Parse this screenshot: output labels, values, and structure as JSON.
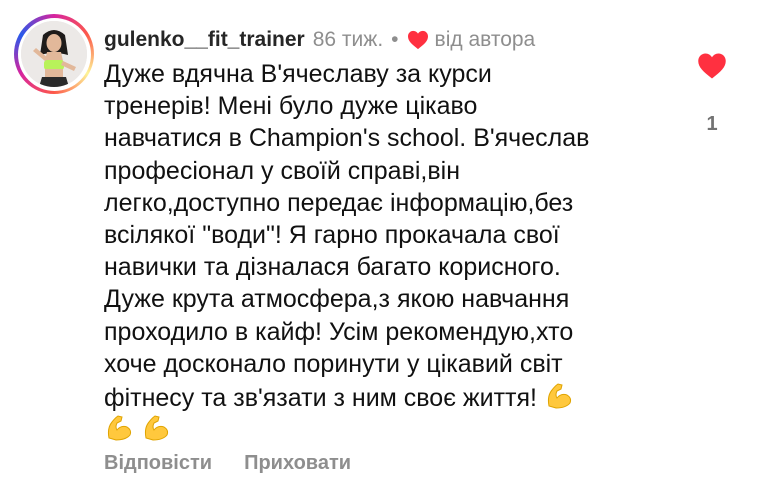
{
  "comment": {
    "username": "gulenko__fit_trainer",
    "time": "86 тиж.",
    "separator": "•",
    "author_badge": "від автора",
    "lines": [
      "Дуже вдячна В'ячеславу за курси",
      "тренерів! Мені було дуже цікаво",
      "навчатися в Champion's school. В'ячеслав",
      "професіонал у своїй справі,він",
      "легко,доступно передає інформацію,без",
      "всілякої \"води\"! Я гарно прокачала свої",
      "навички та дізналася багато корисного.",
      "Дуже крута атмосфера,з якою навчання",
      "проходило в кайф! Усім рекомендую,хто",
      "хоче досконало поринути у  цікавий світ",
      "фітнесу та зв'язати з ним своє життя!"
    ],
    "emoji": "flexed-biceps"
  },
  "actions": {
    "reply_label": "Відповісти",
    "hide_label": "Приховати"
  },
  "like": {
    "count": "1",
    "liked": true,
    "color": "#ff3040"
  }
}
